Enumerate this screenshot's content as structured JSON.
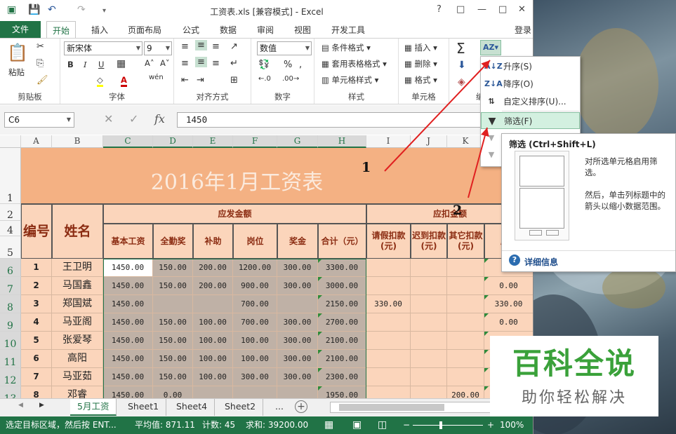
{
  "window": {
    "title": "工资表.xls  [兼容模式] - Excel",
    "login": "登录",
    "buttons": [
      "?",
      "□",
      "—",
      "□",
      "✕"
    ]
  },
  "ribbon_tabs": [
    "文件",
    "开始",
    "插入",
    "页面布局",
    "公式",
    "数据",
    "审阅",
    "视图",
    "开发工具"
  ],
  "ribbon": {
    "clipboard": {
      "label": "剪贴板",
      "paste": "粘贴"
    },
    "font": {
      "label": "字体",
      "name": "新宋体",
      "size": "9"
    },
    "align": {
      "label": "对齐方式"
    },
    "number": {
      "label": "数字",
      "format": "数值"
    },
    "styles": {
      "label": "样式",
      "items": [
        "条件格式",
        "套用表格格式",
        "单元格样式"
      ]
    },
    "cells": {
      "label": "单元格",
      "items": [
        "插入",
        "删除",
        "格式"
      ]
    },
    "edit": {
      "label": "编"
    }
  },
  "formula_bar": {
    "name_box": "C6",
    "fx": "fx",
    "value": "1450"
  },
  "columns": [
    "A",
    "B",
    "C",
    "D",
    "E",
    "F",
    "G",
    "H",
    "I",
    "J",
    "K"
  ],
  "sheet": {
    "title": "2016年1月工资表",
    "group_pay": "应发金额",
    "group_deduct": "应扣金额",
    "h_id": "编号",
    "h_name": "姓名",
    "headers": [
      "基本工资",
      "全勤奖",
      "补助",
      "岗位",
      "奖金",
      "合计（元）",
      "请假扣款(元)",
      "迟到扣款(元)",
      "其它扣款(元)",
      "应扣"
    ],
    "row_numbers": [
      "1",
      "2",
      "4",
      "5",
      "6",
      "7",
      "8",
      "9",
      "10",
      "11",
      "12",
      "13"
    ],
    "rows": [
      {
        "id": "1",
        "name": "王卫明",
        "vals": [
          "1450.00",
          "150.00",
          "200.00",
          "1200.00",
          "300.00",
          "3300.00",
          "",
          "",
          "",
          ""
        ]
      },
      {
        "id": "2",
        "name": "马国鑫",
        "vals": [
          "1450.00",
          "150.00",
          "200.00",
          "900.00",
          "300.00",
          "3000.00",
          "",
          "",
          "",
          "0.00"
        ]
      },
      {
        "id": "3",
        "name": "郑国斌",
        "vals": [
          "1450.00",
          "",
          "",
          "700.00",
          "",
          "2150.00",
          "330.00",
          "",
          "",
          "330.00"
        ]
      },
      {
        "id": "4",
        "name": "马亚阁",
        "vals": [
          "1450.00",
          "150.00",
          "100.00",
          "700.00",
          "300.00",
          "2700.00",
          "",
          "",
          "",
          "0.00"
        ]
      },
      {
        "id": "5",
        "name": "张爱琴",
        "vals": [
          "1450.00",
          "150.00",
          "100.00",
          "100.00",
          "300.00",
          "2100.00",
          "",
          "",
          "",
          ""
        ]
      },
      {
        "id": "6",
        "name": "高阳",
        "vals": [
          "1450.00",
          "150.00",
          "100.00",
          "100.00",
          "300.00",
          "2100.00",
          "",
          "",
          "",
          ""
        ]
      },
      {
        "id": "7",
        "name": "马亚茹",
        "vals": [
          "1450.00",
          "150.00",
          "100.00",
          "300.00",
          "300.00",
          "2300.00",
          "",
          "",
          "",
          ""
        ]
      },
      {
        "id": "8",
        "name": "邓睿",
        "vals": [
          "1450.00",
          "0.00",
          "",
          "",
          "",
          "1950.00",
          "",
          "",
          "200.00",
          ""
        ]
      }
    ]
  },
  "sort_menu": {
    "items": [
      "升序(S)",
      "降序(O)",
      "自定义排序(U)...",
      "筛选(F)",
      "清除",
      "重新应用"
    ]
  },
  "tooltip": {
    "title": "筛选 (Ctrl+Shift+L)",
    "body1": "对所选单元格启用筛选。",
    "body2": "然后，单击列标题中的箭头以缩小数据范围。",
    "more": "详细信息"
  },
  "annotations": [
    "1",
    "2"
  ],
  "sheet_tabs": [
    "5月工资",
    "Sheet1",
    "Sheet4",
    "Sheet2",
    "..."
  ],
  "status": {
    "mode": "选定目标区域，然后按 ENT...",
    "avg": "平均值: 871.11",
    "count": "计数: 45",
    "sum": "求和: 39200.00",
    "zoom": "100%"
  },
  "watermark": {
    "line1": "百科全说",
    "line2": "助你轻松解决"
  },
  "colors": {
    "excel_green": "#217346",
    "header_fill": "#fbd5bb",
    "title_fill": "#f4b183",
    "selection": "#bfb1a6"
  }
}
